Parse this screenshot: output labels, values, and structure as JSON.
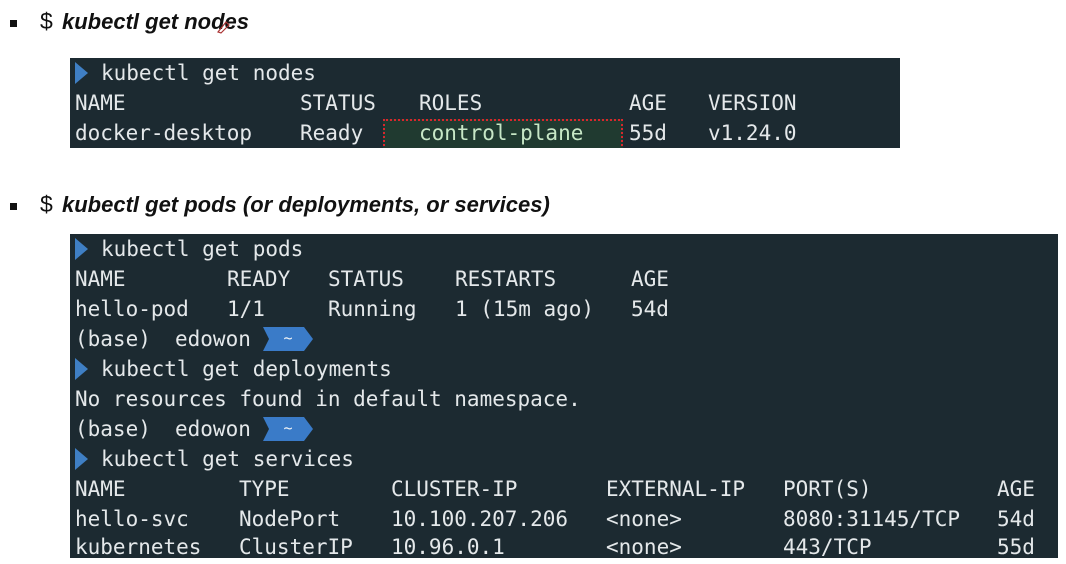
{
  "bullets": [
    {
      "dollar": "$",
      "command": "kubectl get nodes"
    },
    {
      "dollar": "$",
      "command": "kubectl get pods (or deployments, or services)"
    }
  ],
  "terminal1": {
    "prompt_cmd": "kubectl get nodes",
    "headers": [
      "NAME",
      "STATUS",
      "ROLES",
      "AGE",
      "VERSION"
    ],
    "row": [
      "docker-desktop",
      "Ready",
      "control-plane",
      "55d",
      "v1.24.0"
    ]
  },
  "terminal2": {
    "cmd_pods": "kubectl get pods",
    "pods_headers": [
      "NAME",
      "READY",
      "STATUS",
      "RESTARTS",
      "AGE"
    ],
    "pods_row": [
      "hello-pod",
      "1/1",
      "Running",
      "1 (15m ago)",
      "54d"
    ],
    "prompt_env": "(base)",
    "prompt_user": "edowon",
    "prompt_dir": "~",
    "cmd_deployments": "kubectl get deployments",
    "deployments_output": "No resources found in default namespace.",
    "cmd_services": "kubectl get services",
    "svc_headers": [
      "NAME",
      "TYPE",
      "CLUSTER-IP",
      "EXTERNAL-IP",
      "PORT(S)",
      "AGE"
    ],
    "svc_rows": [
      [
        "hello-svc",
        "NodePort",
        "10.100.207.206",
        "<none>",
        "8080:31145/TCP",
        "54d"
      ],
      [
        "kubernetes",
        "ClusterIP",
        "10.96.0.1",
        "<none>",
        "443/TCP",
        "55d"
      ]
    ]
  },
  "colors": {
    "terminal_bg": "#1c2a31",
    "terminal_text": "#e4e8ea",
    "prompt_blue": "#3f7fc4",
    "highlight_border": "#d8262d"
  }
}
